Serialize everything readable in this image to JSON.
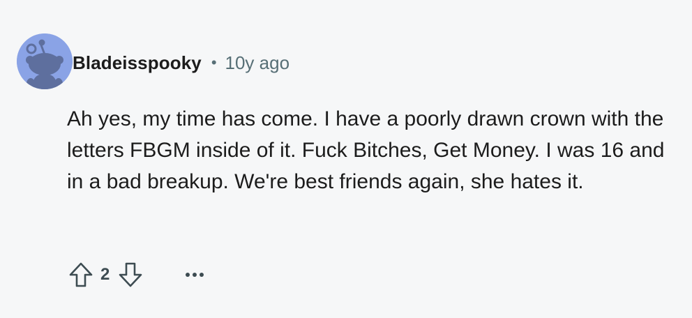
{
  "comment": {
    "author": "Bladeisspooky",
    "separator": "•",
    "timestamp": "10y ago",
    "body": "Ah yes, my time has come. I have a poorly drawn crown with the letters FBGM inside of it. Fuck Bitches, Get Money. I was 16 and in a bad breakup. We're best friends again, she hates it.",
    "score": "2",
    "avatar_icon": "default-snoo-avatar",
    "upvote_icon": "arrow-up-outline-icon",
    "downvote_icon": "arrow-down-outline-icon",
    "more_icon": "ellipsis-horizontal-icon"
  },
  "colors": {
    "background": "#f6f7f8",
    "avatar_bg": "#8aa3e6",
    "text": "#1c1c1c",
    "meta": "#576f76",
    "icon": "#3d4c52"
  }
}
